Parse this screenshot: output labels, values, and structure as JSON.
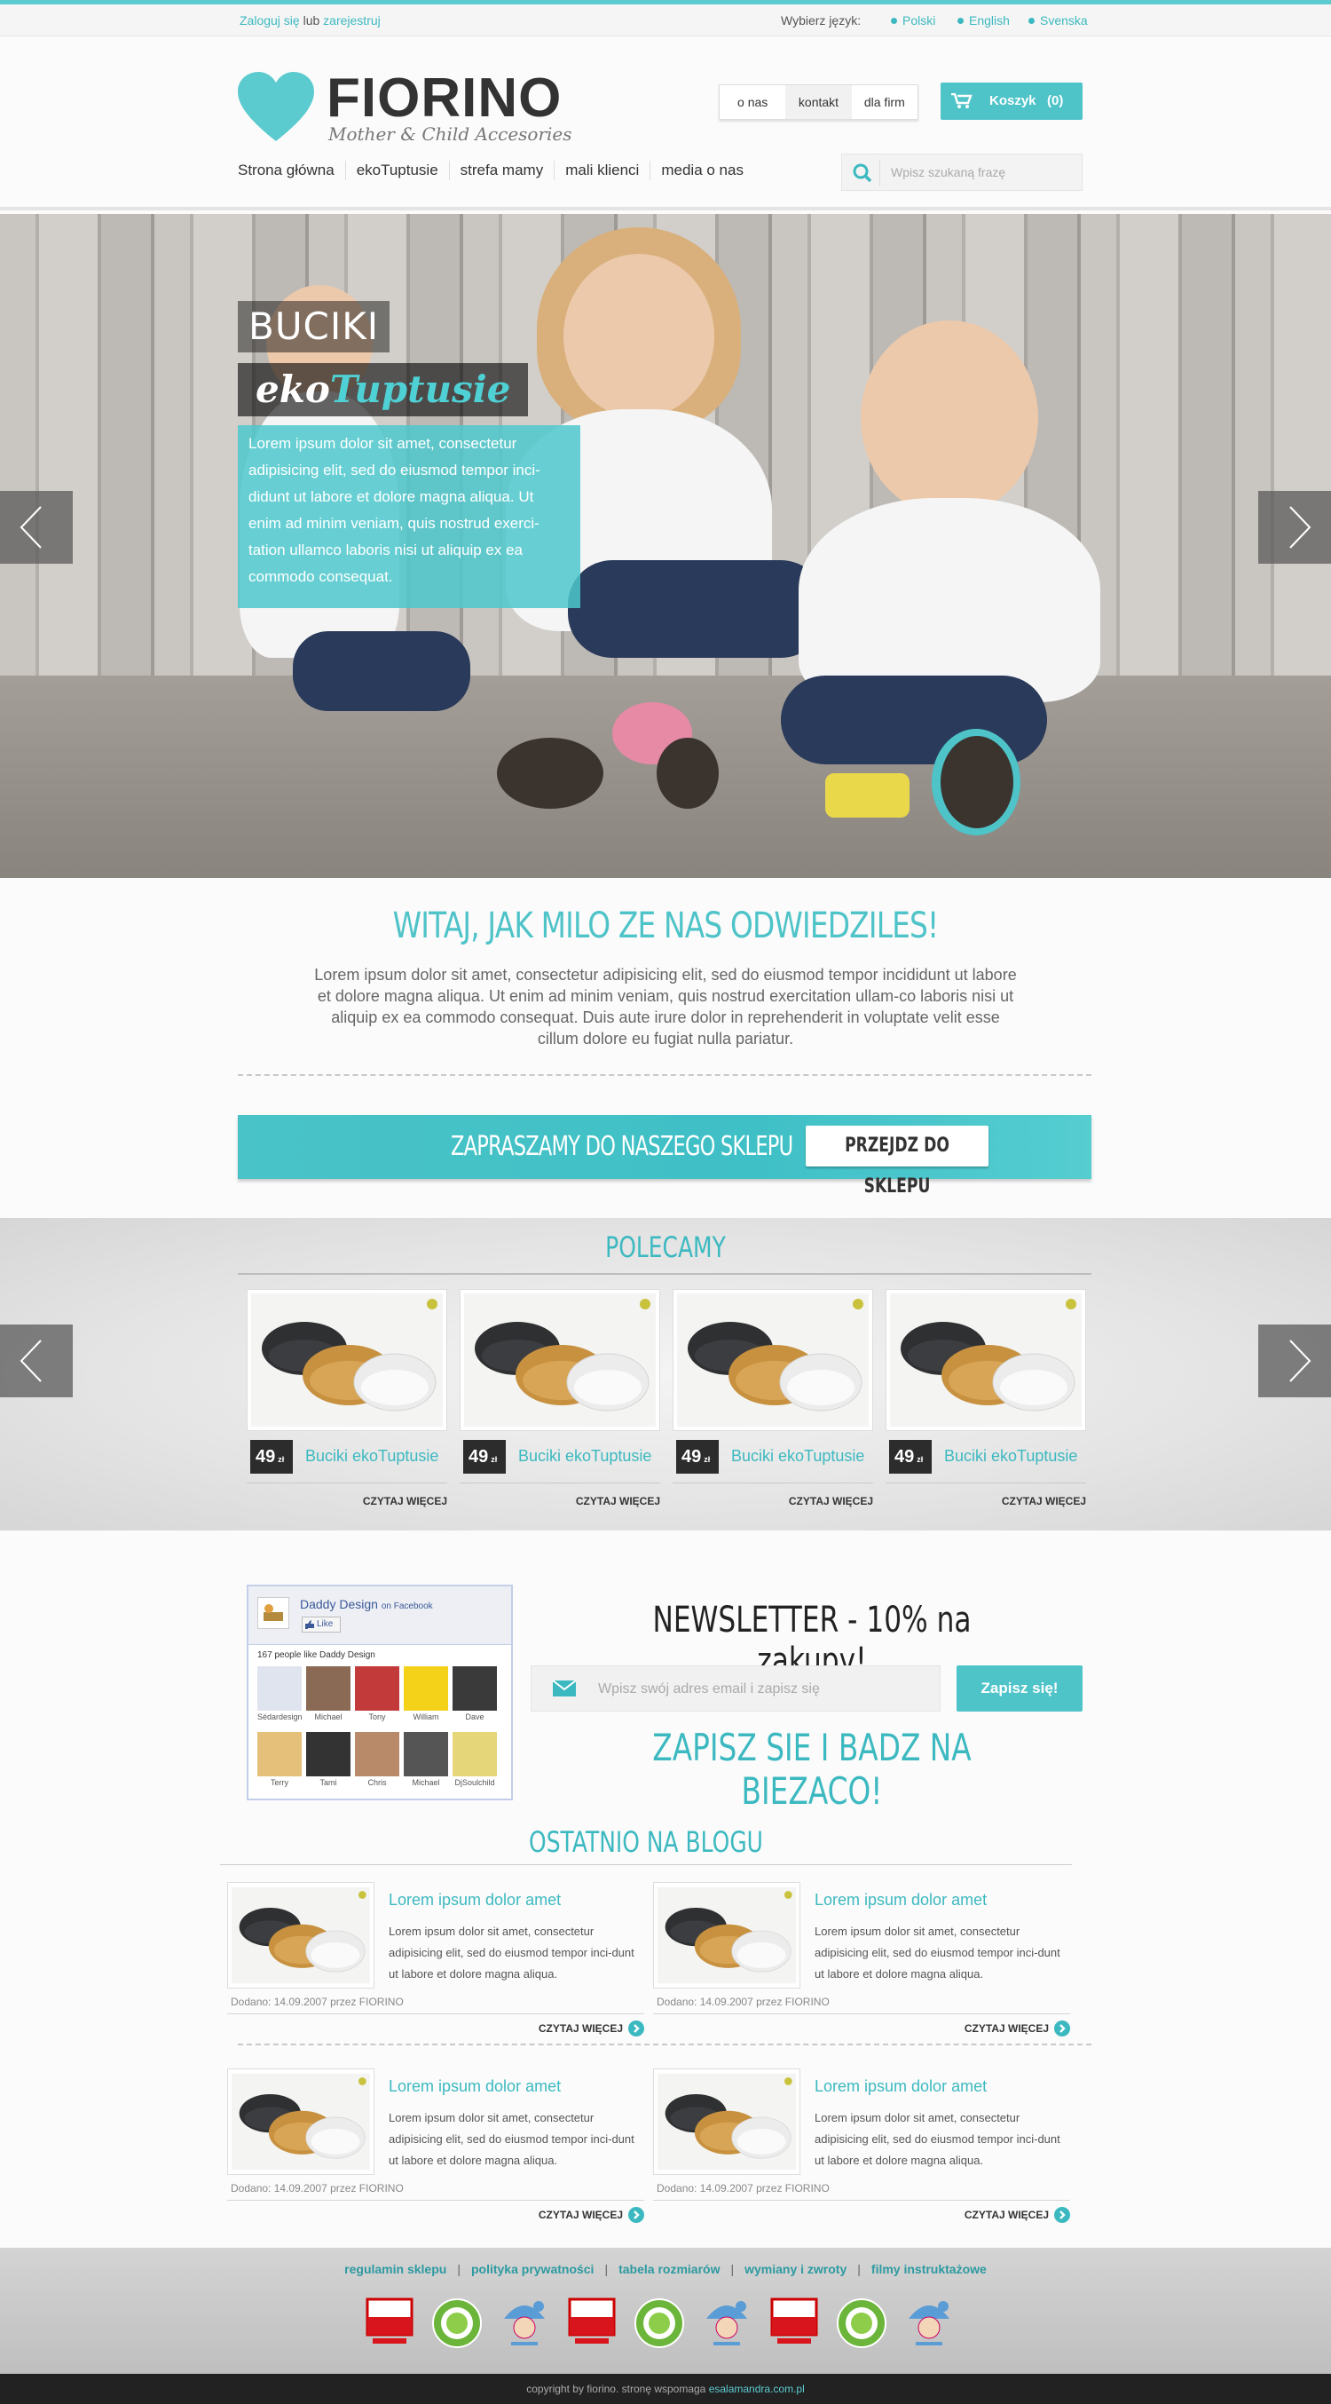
{
  "topbar": {
    "login": "Zaloguj się",
    "or": " lub ",
    "register": "zarejestruj",
    "lang_label": "Wybierz język:",
    "languages": [
      "Polski",
      "English",
      "Svenska"
    ]
  },
  "header": {
    "brand": "FIORINO",
    "tagline": "Mother & Child Accesories",
    "links": [
      "o nas",
      "kontakt",
      "dla firm"
    ],
    "cart_label": "Koszyk",
    "cart_count": "(0)"
  },
  "nav": [
    "Strona główna",
    "ekoTuptusie",
    "strefa mamy",
    "mali klienci",
    "media o nas"
  ],
  "search": {
    "placeholder": "Wpisz szukaną frazę"
  },
  "hero": {
    "title1": "BUCIKI",
    "title2a": "eko",
    "title2b": "Tuptusie",
    "text": "Lorem ipsum dolor sit amet, consectetur adipisicing elit, sed do eiusmod tempor inci-didunt ut labore et dolore magna aliqua. Ut enim ad minim veniam, quis nostrud exerci-tation ullamco laboris nisi ut aliquip ex ea commodo consequat."
  },
  "welcome": {
    "title": "WITAJ, JAK MILO ZE NAS ODWIEDZILES!",
    "text": "Lorem ipsum dolor sit amet, consectetur adipisicing elit, sed do eiusmod tempor incididunt ut labore et dolore magna aliqua. Ut enim ad minim veniam, quis nostrud exercitation ullam-co laboris nisi ut aliquip ex ea commodo consequat. Duis aute irure dolor in reprehenderit in voluptate velit esse cillum dolore eu fugiat nulla pariatur."
  },
  "shop_banner": {
    "text": "ZAPRASZAMY DO NASZEGO SKLEPU",
    "button": "PRZEJDZ DO SKLEPU"
  },
  "polecamy": {
    "title": "POLECAMY",
    "products": [
      {
        "price": "49",
        "currency": "zł",
        "name": "Buciki ekoTuptusie",
        "more": "CZYTAJ WIĘCEJ"
      },
      {
        "price": "49",
        "currency": "zł",
        "name": "Buciki ekoTuptusie",
        "more": "CZYTAJ WIĘCEJ"
      },
      {
        "price": "49",
        "currency": "zł",
        "name": "Buciki ekoTuptusie",
        "more": "CZYTAJ WIĘCEJ"
      },
      {
        "price": "49",
        "currency": "zł",
        "name": "Buciki ekoTuptusie",
        "more": "CZYTAJ WIĘCEJ"
      }
    ]
  },
  "facebook": {
    "page": "Daddy Design",
    "on": "on Facebook",
    "like": "Like",
    "count": "167 people like Daddy Design",
    "people": [
      "Sédardesign",
      "Michael",
      "Tony",
      "William",
      "Dave",
      "Terry",
      "Tami",
      "Chris",
      "Michael",
      "DjSoulchild"
    ]
  },
  "newsletter": {
    "title": "NEWSLETTER - 10% na zakupy!",
    "placeholder": "Wpisz swój adres email i zapisz się",
    "button": "Zapisz się!",
    "subtitle": "ZAPISZ SIE I BADZ NA BIEZACO!"
  },
  "blog": {
    "title": "OSTATNIO NA BLOGU",
    "posts": [
      {
        "title": "Lorem ipsum dolor amet",
        "text": "Lorem ipsum dolor sit amet, consectetur adipisicing elit, sed do eiusmod tempor inci-dunt ut labore et dolore magna aliqua.",
        "date": "Dodano: 14.09.2007 przez FIORINO",
        "more": "CZYTAJ WIĘCEJ"
      },
      {
        "title": "Lorem ipsum dolor amet",
        "text": "Lorem ipsum dolor sit amet, consectetur adipisicing elit, sed do eiusmod tempor inci-dunt ut labore et dolore magna aliqua.",
        "date": "Dodano: 14.09.2007 przez FIORINO",
        "more": "CZYTAJ WIĘCEJ"
      },
      {
        "title": "Lorem ipsum dolor amet",
        "text": "Lorem ipsum dolor sit amet, consectetur adipisicing elit, sed do eiusmod tempor inci-dunt ut labore et dolore magna aliqua.",
        "date": "Dodano: 14.09.2007 przez FIORINO",
        "more": "CZYTAJ WIĘCEJ"
      },
      {
        "title": "Lorem ipsum dolor amet",
        "text": "Lorem ipsum dolor sit amet, consectetur adipisicing elit, sed do eiusmod tempor inci-dunt ut labore et dolore magna aliqua.",
        "date": "Dodano: 14.09.2007 przez FIORINO",
        "more": "CZYTAJ WIĘCEJ"
      }
    ]
  },
  "footer": {
    "links": [
      "regulamin sklepu",
      "polityka prywatności",
      "tabela rozmiarów",
      "wymiany i zwroty",
      "filmy instruktażowe"
    ],
    "separator": "|",
    "badges": [
      "teraz-polska",
      "eco-certificate",
      "safe-for-child",
      "teraz-polska",
      "eco-certificate",
      "safe-for-child",
      "teraz-polska",
      "eco-certificate",
      "safe-for-child"
    ],
    "copyright": "copyright by fiorino. stronę wspomaga ",
    "copyright_link": "esalamandra.com.pl"
  },
  "colors": {
    "accent": "#4ec3c8",
    "dark": "#2c2c2c"
  }
}
